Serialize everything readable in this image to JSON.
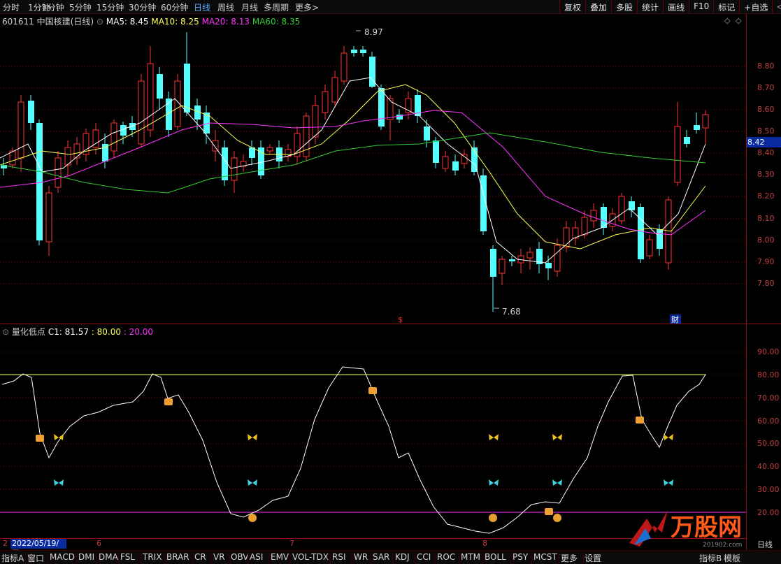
{
  "topbar": {
    "periods": [
      "分时",
      "1分钟",
      "5分钟",
      "15分钟",
      "30分钟",
      "60分钟",
      "日线",
      "周线",
      "月线",
      "多周期",
      "更多"
    ],
    "active_period": "日线",
    "more_arrow": ">",
    "right_buttons": [
      "复权",
      "叠加",
      "多股",
      "统计",
      "画线",
      "F10",
      "标记",
      "+自选",
      "◁"
    ]
  },
  "main_legend": {
    "code": "601611",
    "name": "中国核建",
    "period": "(日线)",
    "ma5": "MA5: 8.45",
    "ma10": "MA10: 8.25",
    "ma20": "MA20: 8.13",
    "ma60": "MA60: 8.35"
  },
  "colors": {
    "up": "#ff3232",
    "down": "#54ffff",
    "ma5": "#ffffff",
    "ma10": "#ffff55",
    "ma20": "#ff33ff",
    "ma60": "#33cc33",
    "grid": "#7a1010",
    "axis_text": "#c04040"
  },
  "price_axis": [
    "8.80",
    "8.70",
    "8.60",
    "8.50",
    "8.40",
    "8.30",
    "8.20",
    "8.10",
    "8.00",
    "7.90",
    "7.80"
  ],
  "last_price": "8.42",
  "annotations": {
    "high": "8.97",
    "low": "7.68",
    "marker_s": "$",
    "marker_cai": "财"
  },
  "indicator": {
    "title": "量化低点",
    "c1": "C1: 81.57",
    "l80": ": 80.00",
    "l20": ": 20.00",
    "axis": [
      "90.00",
      "80.00",
      "70.00",
      "60.00",
      "50.00",
      "40.00",
      "30.00",
      "20.00"
    ]
  },
  "xaxis": {
    "date": "2022/05/19/四",
    "months": [
      "6",
      "7",
      "8"
    ],
    "period_label": "日线"
  },
  "bottom_tabs": [
    "指标A",
    "窗口",
    "MACD",
    "DMI",
    "DMA",
    "FSL",
    "TRIX",
    "BRAR",
    "CR",
    "VR",
    "OBV",
    "ASI",
    "EMV",
    "VOL-TDX",
    "RSI",
    "WR",
    "SAR",
    "KDJ",
    "CCI",
    "ROC",
    "MTM",
    "BOLL",
    "PSY",
    "MCST",
    "更多",
    "设置"
  ],
  "bottom_right": [
    "指标B",
    "模板"
  ],
  "logo": {
    "text": "万股网",
    "url_text": "201902.com"
  }
}
